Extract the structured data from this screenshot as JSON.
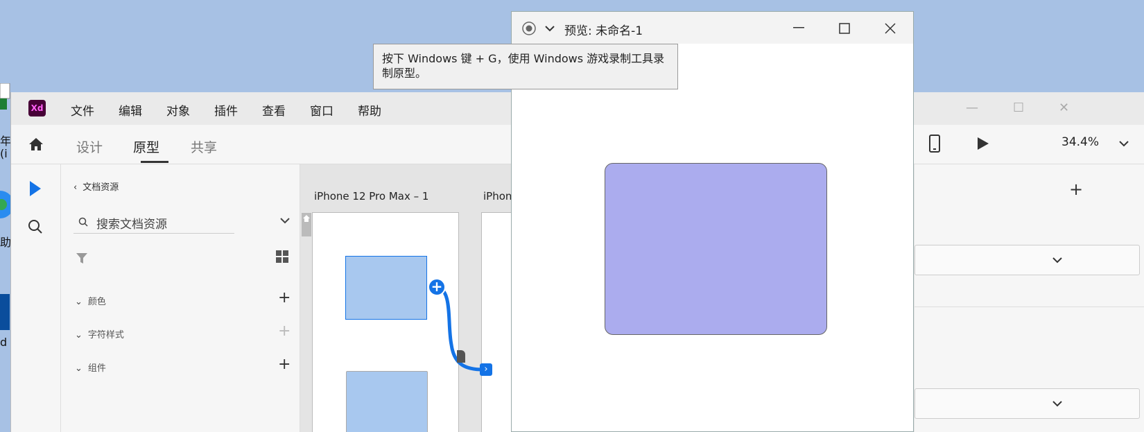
{
  "desktop": {
    "fragment_1": "年",
    "fragment_2": "(i",
    "fragment_3": "助",
    "fragment_4": "d"
  },
  "xd": {
    "logo": "Xd",
    "menu": [
      "文件",
      "编辑",
      "对象",
      "插件",
      "查看",
      "窗口",
      "帮助"
    ],
    "tabs": [
      {
        "label": "设计",
        "active": false
      },
      {
        "label": "原型",
        "active": true
      },
      {
        "label": "共享",
        "active": false
      }
    ],
    "zoom": "34.4%",
    "assets": {
      "back_label": "文档资源",
      "search_placeholder": "搜索文档资源",
      "sections": [
        {
          "label": "颜色",
          "add_enabled": true
        },
        {
          "label": "字符样式",
          "add_enabled": false
        },
        {
          "label": "组件",
          "add_enabled": true
        }
      ]
    },
    "canvas": {
      "artboard_1_label": "iPhone 12 Pro Max – 1",
      "artboard_2_label": "iPhon"
    }
  },
  "preview": {
    "title": "预览: 未命名-1"
  },
  "tooltip": {
    "line1": "按下 Windows 键 + G，使用 Windows 游戏录制工具录",
    "line2": "制原型。"
  },
  "colors": {
    "desktop_bg": "#a7c1e4",
    "xd_logo_bg": "#470137",
    "accent_blue": "#1473e6",
    "preview_rect": "#abacee",
    "canvas_rect": "#a8c8ef"
  }
}
